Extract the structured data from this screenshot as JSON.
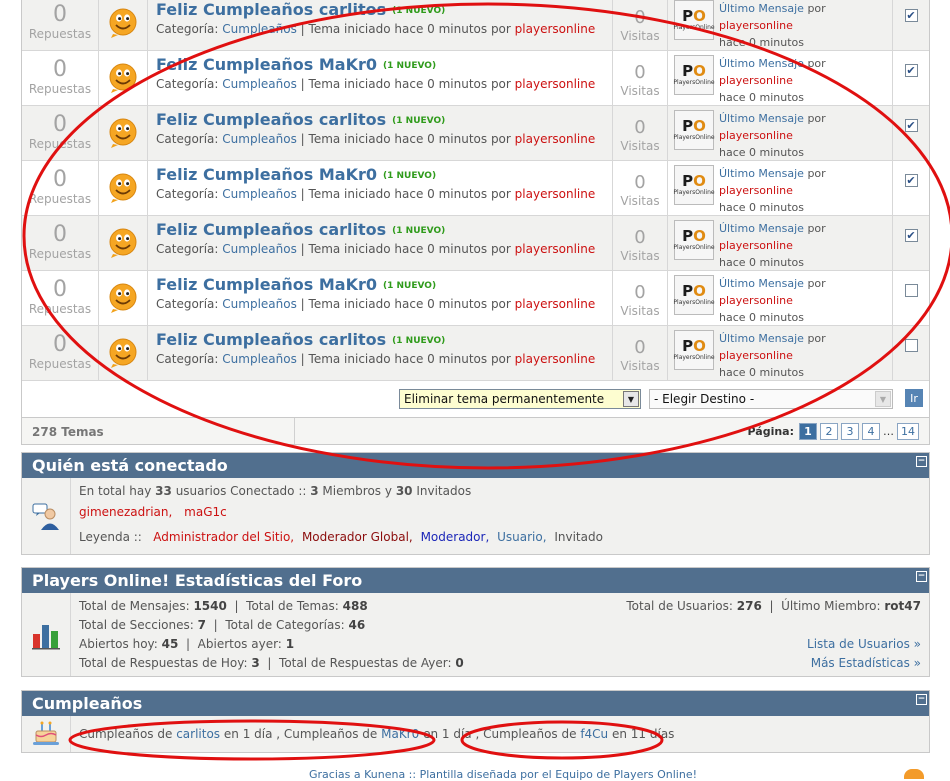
{
  "topics": [
    {
      "replies": "0",
      "replies_label": "Repuestas",
      "title": "Feliz Cumpleaños carlitos",
      "new_badge": "(1 NUEVO)",
      "cat_label": "Categoría:",
      "category": "Cumpleaños",
      "started": "| Tema iniciado hace 0 minutos por",
      "author": "playersonline",
      "views": "0",
      "views_label": "Visitas",
      "last_msg": "Último Mensaje",
      "by": "por",
      "last_author": "playersonline",
      "last_time": "hace 0 minutos",
      "checked": true
    },
    {
      "replies": "0",
      "replies_label": "Repuestas",
      "title": "Feliz Cumpleaños MaKr0",
      "new_badge": "(1 NUEVO)",
      "cat_label": "Categoría:",
      "category": "Cumpleaños",
      "started": "| Tema iniciado hace 0 minutos por",
      "author": "playersonline",
      "views": "0",
      "views_label": "Visitas",
      "last_msg": "Último Mensaje",
      "by": "por",
      "last_author": "playersonline",
      "last_time": "hace 0 minutos",
      "checked": true
    },
    {
      "replies": "0",
      "replies_label": "Repuestas",
      "title": "Feliz Cumpleaños carlitos",
      "new_badge": "(1 NUEVO)",
      "cat_label": "Categoría:",
      "category": "Cumpleaños",
      "started": "| Tema iniciado hace 0 minutos por",
      "author": "playersonline",
      "views": "0",
      "views_label": "Visitas",
      "last_msg": "Último Mensaje",
      "by": "por",
      "last_author": "playersonline",
      "last_time": "hace 0 minutos",
      "checked": true
    },
    {
      "replies": "0",
      "replies_label": "Repuestas",
      "title": "Feliz Cumpleaños MaKr0",
      "new_badge": "(1 NUEVO)",
      "cat_label": "Categoría:",
      "category": "Cumpleaños",
      "started": "| Tema iniciado hace 0 minutos por",
      "author": "playersonline",
      "views": "0",
      "views_label": "Visitas",
      "last_msg": "Último Mensaje",
      "by": "por",
      "last_author": "playersonline",
      "last_time": "hace 0 minutos",
      "checked": true
    },
    {
      "replies": "0",
      "replies_label": "Repuestas",
      "title": "Feliz Cumpleaños carlitos",
      "new_badge": "(1 NUEVO)",
      "cat_label": "Categoría:",
      "category": "Cumpleaños",
      "started": "| Tema iniciado hace 0 minutos por",
      "author": "playersonline",
      "views": "0",
      "views_label": "Visitas",
      "last_msg": "Último Mensaje",
      "by": "por",
      "last_author": "playersonline",
      "last_time": "hace 0 minutos",
      "checked": true
    },
    {
      "replies": "0",
      "replies_label": "Repuestas",
      "title": "Feliz Cumpleaños MaKr0",
      "new_badge": "(1 NUEVO)",
      "cat_label": "Categoría:",
      "category": "Cumpleaños",
      "started": "| Tema iniciado hace 0 minutos por",
      "author": "playersonline",
      "views": "0",
      "views_label": "Visitas",
      "last_msg": "Último Mensaje",
      "by": "por",
      "last_author": "playersonline",
      "last_time": "hace 0 minutos",
      "checked": false
    },
    {
      "replies": "0",
      "replies_label": "Repuestas",
      "title": "Feliz Cumpleaños carlitos",
      "new_badge": "(1 NUEVO)",
      "cat_label": "Categoría:",
      "category": "Cumpleaños",
      "started": "| Tema iniciado hace 0 minutos por",
      "author": "playersonline",
      "views": "0",
      "views_label": "Visitas",
      "last_msg": "Último Mensaje",
      "by": "por",
      "last_author": "playersonline",
      "last_time": "hace 0 minutos",
      "checked": false
    }
  ],
  "avatar": {
    "mark_p": "P",
    "mark_o": "O",
    "caption": "PlayersOnline"
  },
  "moderation": {
    "action_select": "Eliminar tema permanentemente",
    "dest_select": "- Elegir Destino -",
    "go": "Ir"
  },
  "summary": {
    "count": "278 Temas",
    "page_label": "Página:",
    "pages": [
      "1",
      "2",
      "3",
      "4"
    ],
    "ellipsis": "…",
    "last_page": "14"
  },
  "online": {
    "title": "Quién está conectado",
    "collapse": "−",
    "t1": "En total hay",
    "total": "33",
    "t2": "usuarios Conectado  ::",
    "members": "3",
    "t3": "Miembros y",
    "guests": "30",
    "t4": "Invitados",
    "users": [
      "gimenezadrian,",
      "maG1c"
    ],
    "legend_label": "Leyenda ::",
    "legend": {
      "admin": "Administrador del Sitio,",
      "global": "Moderador Global,",
      "mod": "Moderador,",
      "user": "Usuario,",
      "guest": "Invitado"
    }
  },
  "stats": {
    "title": "Players Online! Estadísticas del Foro",
    "collapse": "−",
    "l_msgs": "Total de Mensajes:",
    "msgs": "1540",
    "l_topics": "Total de Temas:",
    "topics": "488",
    "l_sections": "Total de Secciones:",
    "sections": "7",
    "l_cats": "Total de Categorías:",
    "cats": "46",
    "l_open_today": "Abiertos hoy:",
    "open_today": "45",
    "l_open_yest": "Abiertos ayer:",
    "open_yest": "1",
    "l_resp_today": "Total de Respuestas de Hoy:",
    "resp_today": "3",
    "l_resp_yest": "Total de Respuestas de Ayer:",
    "resp_yest": "0",
    "l_users": "Total de Usuarios:",
    "users": "276",
    "l_last_member": "Último Miembro:",
    "last_member": "rot47",
    "user_list": "Lista de Usuarios »",
    "more_stats": "Más Estadísticas »"
  },
  "birthdays": {
    "title": "Cumpleaños",
    "collapse": "−",
    "p1": "Cumpleaños de",
    "u1": "carlitos",
    "d1": "en 1 día ,",
    "p2": "Cumpleaños de",
    "u2": "MaKr0",
    "d2": "en 1 día ,",
    "p3": "Cumpleaños de",
    "u3": "f4Cu",
    "d3": "en 11 días"
  },
  "footer": {
    "text": "Gracias a Kunena :: Plantilla diseñada por el Equipo de Players Online!"
  },
  "colors": {
    "header_bg": "#516f8e",
    "link": "#3d6fa0",
    "red": "#cc1111",
    "annotation": "#e01010"
  }
}
